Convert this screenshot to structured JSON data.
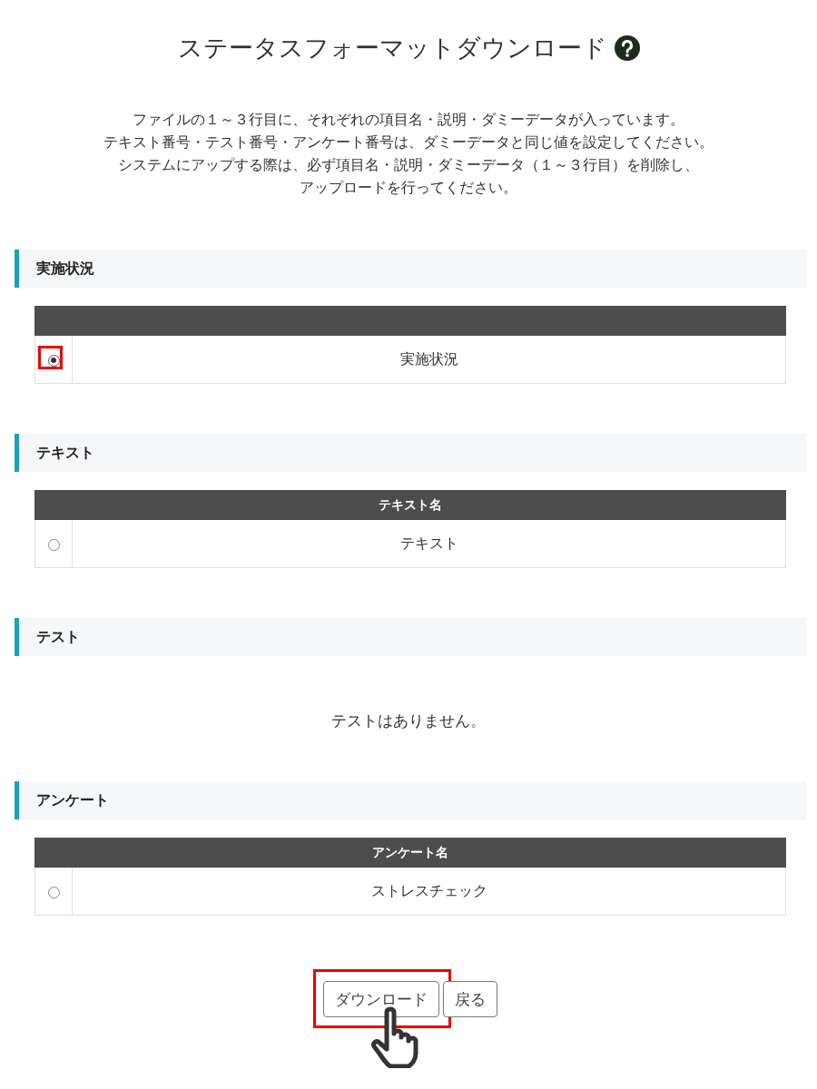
{
  "title": "ステータスフォーマットダウンロード",
  "description": [
    "ファイルの１～３行目に、それぞれの項目名・説明・ダミーデータが入っています。",
    "テキスト番号・テスト番号・アンケート番号は、ダミーデータと同じ値を設定してください。",
    "システムにアップする際は、必ず項目名・説明・ダミーデータ（１～３行目）を削除し、",
    "アップロードを行ってください。"
  ],
  "sections": [
    {
      "title": "実施状況",
      "kind": "table",
      "rows": [
        {
          "label": "実施状況",
          "selected": true,
          "highlighted": true
        }
      ]
    },
    {
      "title": "テキスト",
      "kind": "table",
      "column_header": "テキスト名",
      "rows": [
        {
          "label": "テキスト",
          "selected": false,
          "highlighted": false
        }
      ]
    },
    {
      "title": "テスト",
      "kind": "empty",
      "message": "テストはありません。"
    },
    {
      "title": "アンケート",
      "kind": "table",
      "column_header": "アンケート名",
      "rows": [
        {
          "label": "ストレスチェック",
          "selected": false,
          "highlighted": false
        }
      ]
    }
  ],
  "buttons": [
    {
      "label": "ダウンロード",
      "highlighted": true
    },
    {
      "label": "戻る",
      "highlighted": false
    }
  ]
}
